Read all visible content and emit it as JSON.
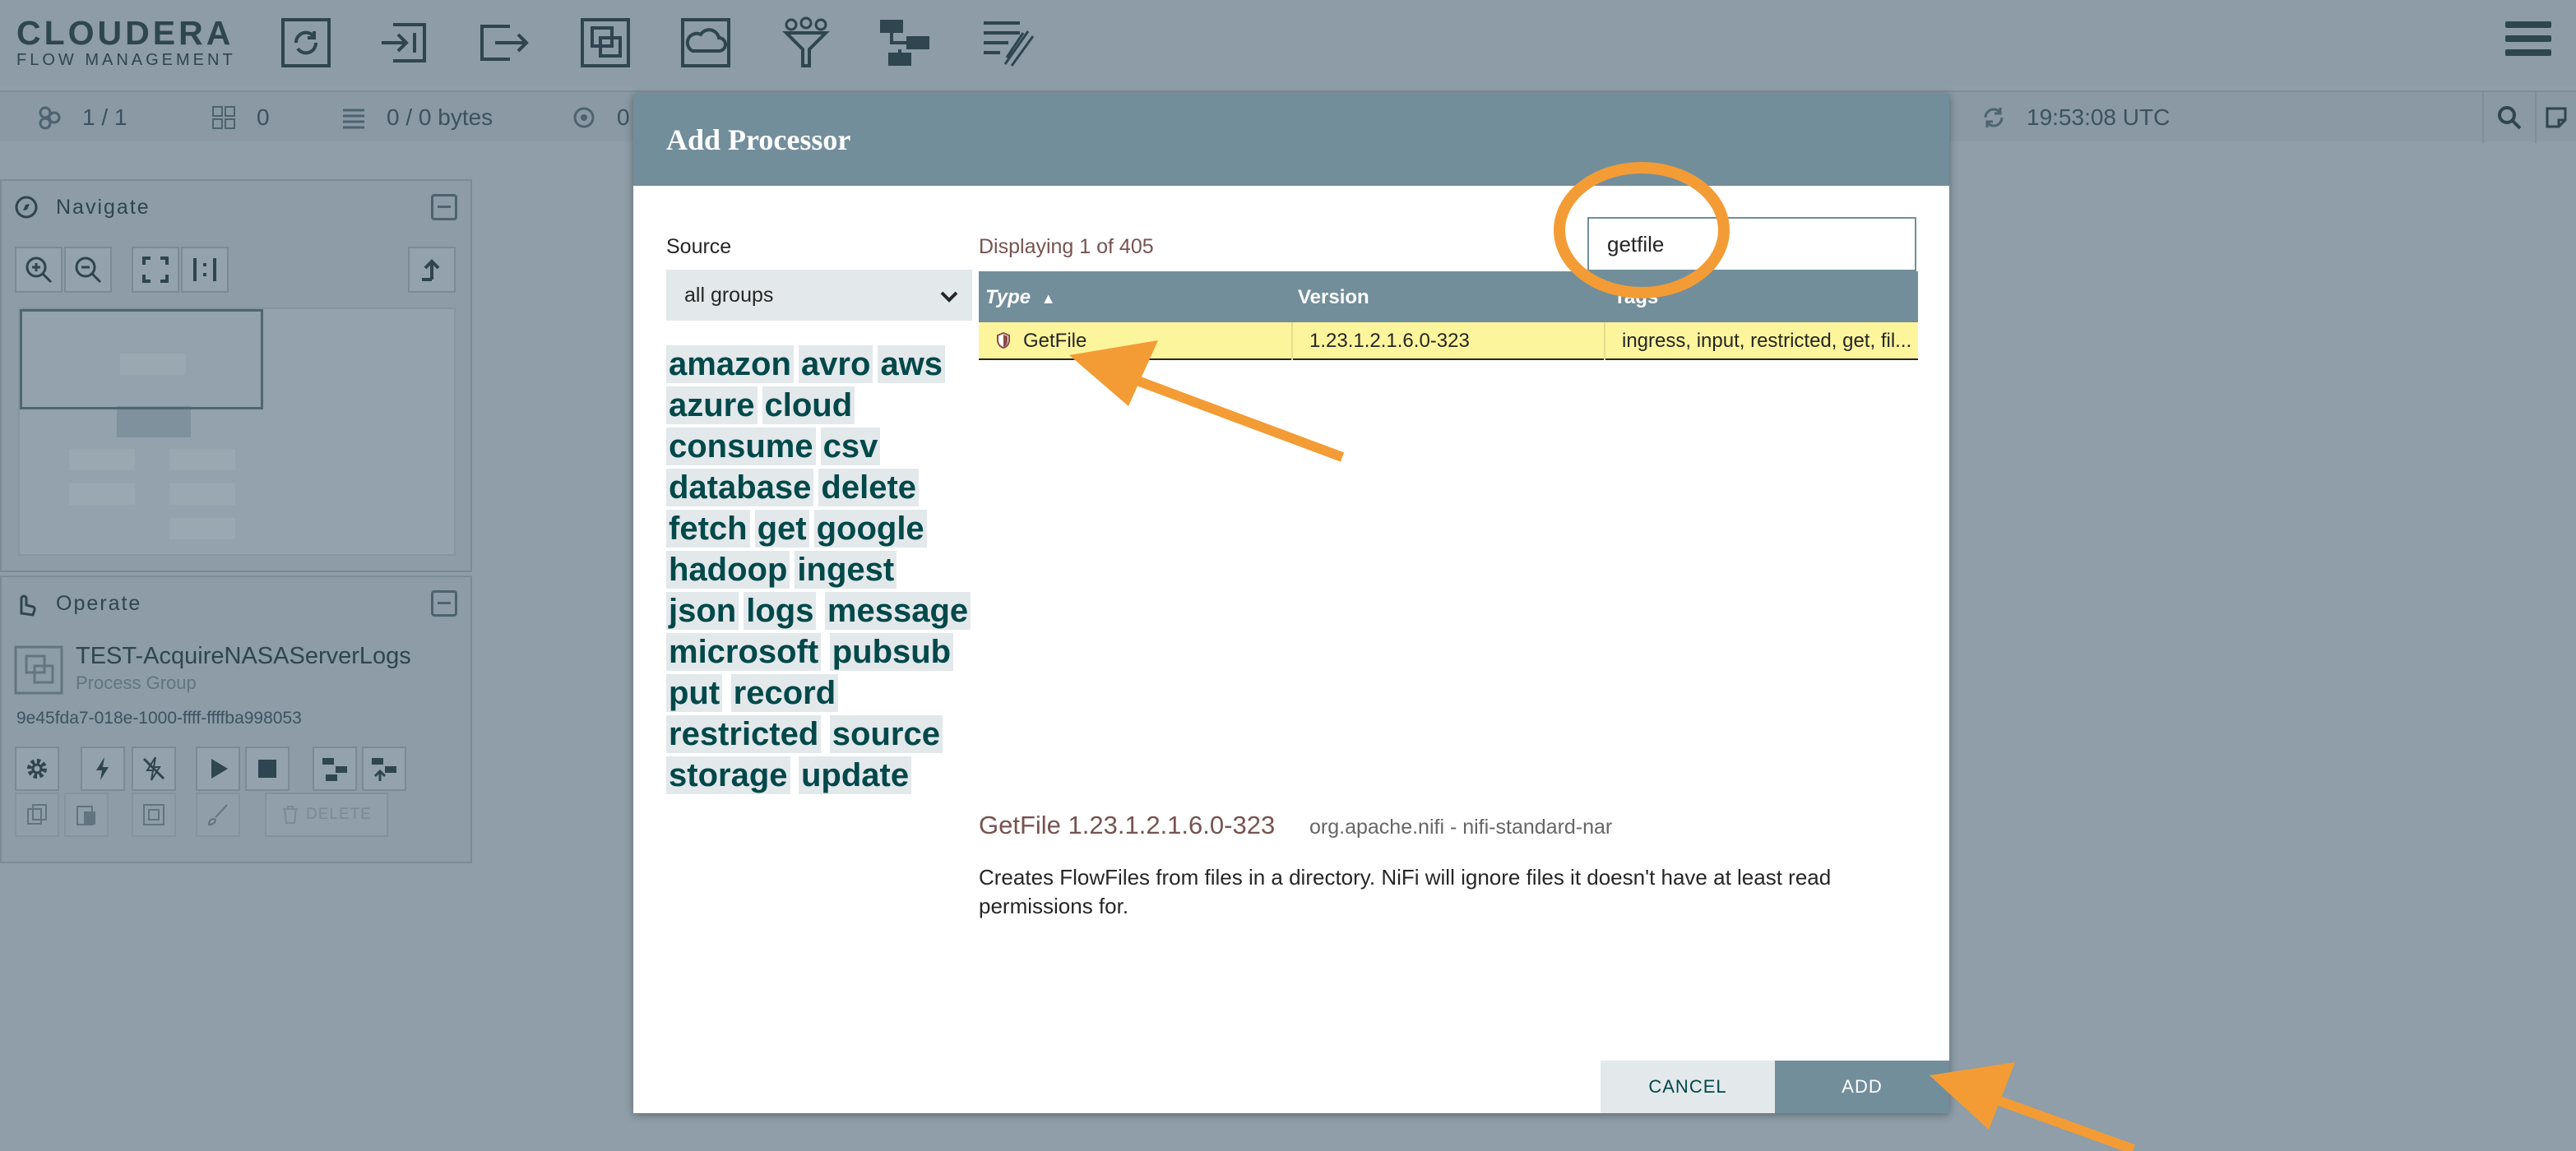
{
  "header": {
    "logo_line1": "CLOUDERA",
    "logo_line2": "FLOW MANAGEMENT",
    "toolbar_icons": [
      "processor-icon",
      "input-port-icon",
      "output-port-icon",
      "process-group-icon",
      "remote-process-group-icon",
      "funnel-icon",
      "template-icon",
      "label-icon"
    ]
  },
  "status": {
    "threads": "1 / 1",
    "transmitting": "0",
    "queued": "0 / 0 bytes",
    "stopped": "0",
    "refresh_time": "19:53:08 UTC"
  },
  "navigate": {
    "title": "Navigate"
  },
  "operate": {
    "title": "Operate",
    "name": "TEST-AcquireNASAServerLogs",
    "type": "Process Group",
    "id": "9e45fda7-018e-1000-ffff-ffffba998053",
    "delete_label": "DELETE"
  },
  "dialog": {
    "title": "Add Processor",
    "source_label": "Source",
    "source_value": "all groups",
    "tags": [
      "amazon",
      "avro",
      "aws",
      "azure",
      "cloud",
      "consume",
      "csv",
      "database",
      "delete",
      "fetch",
      "get",
      "google",
      "hadoop",
      "ingest",
      "json",
      "logs",
      "message",
      "microsoft",
      "pubsub",
      "put",
      "record",
      "restricted",
      "source",
      "storage",
      "update"
    ],
    "displaying": "Displaying 1 of 405",
    "filter_value": "getfile",
    "columns": {
      "type": "Type",
      "version": "Version",
      "tags": "Tags"
    },
    "rows": [
      {
        "type": "GetFile",
        "version": "1.23.1.2.1.6.0-323",
        "tags": "ingress, input, restricted, get, fil..."
      }
    ],
    "selected_title": "GetFile 1.23.1.2.1.6.0-323",
    "selected_bundle": "org.apache.nifi - nifi-standard-nar",
    "selected_desc": "Creates FlowFiles from files in a directory. NiFi will ignore files it doesn't have at least read permissions for.",
    "cancel_label": "CANCEL",
    "add_label": "ADD"
  },
  "colors": {
    "accent": "#728e9b",
    "selected_row": "#fcf59c",
    "annotation": "#f39c35",
    "tag_text": "#004849"
  }
}
